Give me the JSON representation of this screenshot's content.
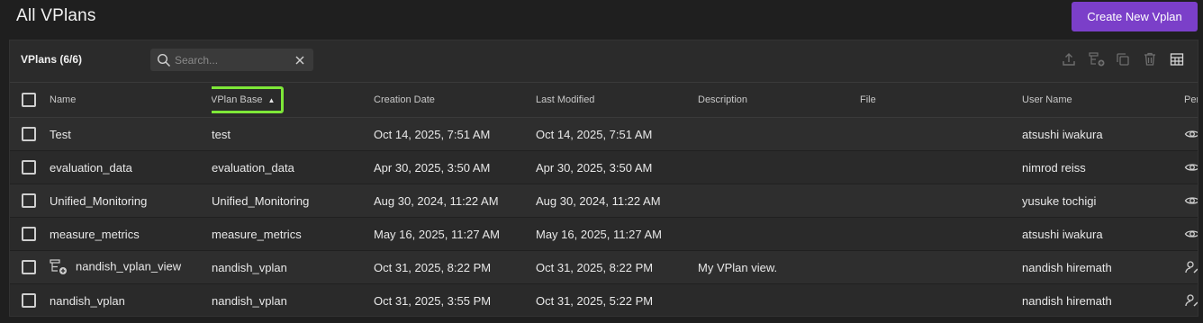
{
  "header": {
    "title": "All VPlans",
    "create_button": "Create New Vplan"
  },
  "toolbar": {
    "count_label": "VPlans (6/6)",
    "search_placeholder": "Search...",
    "icons": [
      "upload-icon",
      "add-view-icon",
      "copy-icon",
      "delete-icon",
      "table-columns-icon"
    ]
  },
  "colors": {
    "accent": "#7b3fc9",
    "highlight": "#7ee838"
  },
  "table": {
    "columns": {
      "name": "Name",
      "base": "VPlan Base",
      "created": "Creation Date",
      "modified": "Last Modified",
      "description": "Description",
      "file": "File",
      "user": "User Name",
      "perm": "Per"
    },
    "sort": {
      "column": "VPlan Base",
      "direction": "ascending"
    },
    "rows": [
      {
        "name": "Test",
        "base": "test",
        "created": "Oct 14, 2025, 7:51 AM",
        "modified": "Oct 14, 2025, 7:51 AM",
        "description": "",
        "file": "",
        "user": "atsushi iwakura",
        "perm_icon": "eye-icon"
      },
      {
        "name": "evaluation_data",
        "base": "evaluation_data",
        "created": "Apr 30, 2025, 3:50 AM",
        "modified": "Apr 30, 2025, 3:50 AM",
        "description": "",
        "file": "",
        "user": "nimrod reiss",
        "perm_icon": "eye-icon"
      },
      {
        "name": "Unified_Monitoring",
        "base": "Unified_Monitoring",
        "created": "Aug 30, 2024, 11:22 AM",
        "modified": "Aug 30, 2024, 11:22 AM",
        "description": "",
        "file": "",
        "user": "yusuke tochigi",
        "perm_icon": "eye-icon"
      },
      {
        "name": "measure_metrics",
        "base": "measure_metrics",
        "created": "May 16, 2025, 11:27 AM",
        "modified": "May 16, 2025, 11:27 AM",
        "description": "",
        "file": "",
        "user": "atsushi iwakura",
        "perm_icon": "eye-icon"
      },
      {
        "name": "nandish_vplan_view",
        "base": "nandish_vplan",
        "created": "Oct 31, 2025, 8:22 PM",
        "modified": "Oct 31, 2025, 8:22 PM",
        "description": "My VPlan view.",
        "file": "",
        "user": "nandish hiremath",
        "perm_icon": "user-edit-icon",
        "name_icon": "vplan-view-icon"
      },
      {
        "name": "nandish_vplan",
        "base": "nandish_vplan",
        "created": "Oct 31, 2025, 3:55 PM",
        "modified": "Oct 31, 2025, 5:22 PM",
        "description": "",
        "file": "",
        "user": "nandish hiremath",
        "perm_icon": "user-edit-icon"
      }
    ]
  }
}
